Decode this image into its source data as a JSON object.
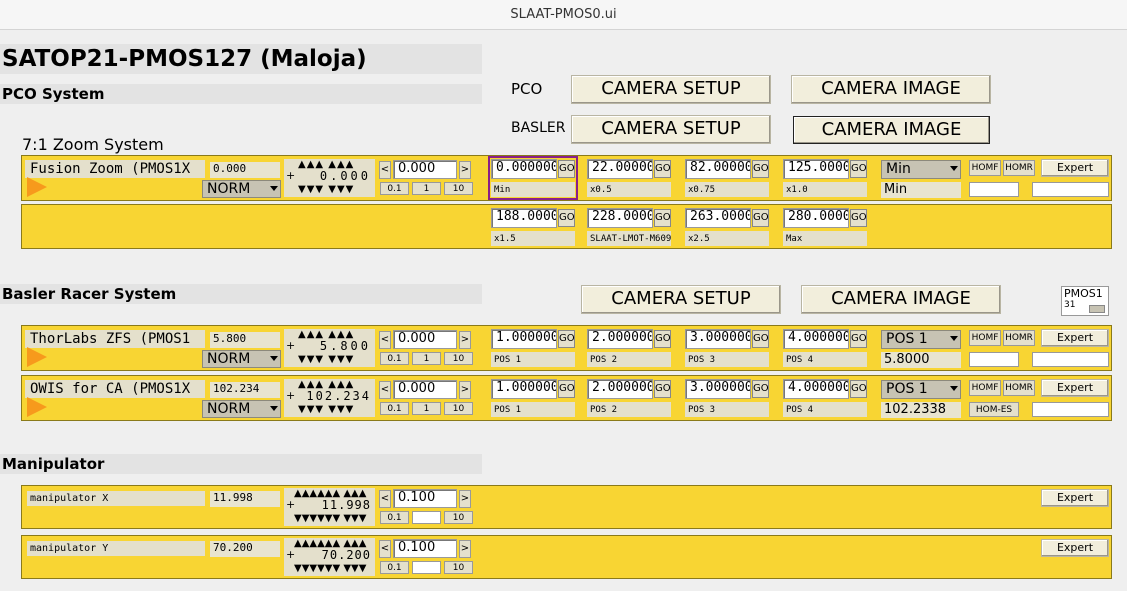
{
  "window": {
    "title": "SLAAT-PMOS0.ui"
  },
  "main_title": "SATOP21-PMOS127 (Maloja)",
  "pco_system": {
    "title": "PCO System",
    "pco_label": "PCO",
    "basler_label": "BASLER",
    "camera_setup": "CAMERA SETUP",
    "camera_image": "CAMERA IMAGE",
    "zoom_label": "7:1 Zoom System"
  },
  "motor_common": {
    "norm": "NORM",
    "tweak_value": "0.000",
    "s1": "0.1",
    "s2": "1",
    "s3": "10",
    "go": "GO",
    "homf": "HOMF",
    "homr": "HOMR",
    "expert": "Expert",
    "left": "<",
    "right": ">",
    "plus": "+",
    "up_arrows": "▲▲▲ ▲▲▲",
    "down_arrows": "▼▼▼ ▼▼▼"
  },
  "fusion": {
    "name": "Fusion Zoom (PMOS1X",
    "readback": "0.000",
    "spin": "0.000",
    "positions": [
      {
        "value": "0.000000",
        "label": "Min"
      },
      {
        "value": "22.00000",
        "label": "x0.5"
      },
      {
        "value": "82.00000",
        "label": "x0.75"
      },
      {
        "value": "125.0000",
        "label": "x1.0"
      },
      {
        "value": "188.0000",
        "label": "x1.5"
      },
      {
        "value": "228.0000",
        "label": "SLAAT-LMOT-M609"
      },
      {
        "value": "263.0000",
        "label": "x2.5"
      },
      {
        "value": "280.0000",
        "label": "Max"
      }
    ],
    "selector": "Min",
    "selector_rbv": "Min"
  },
  "basler_system": {
    "title": "Basler Racer System",
    "camera_setup": "CAMERA SETUP",
    "camera_image": "CAMERA IMAGE",
    "pmos_label": "PMOS1",
    "pmos_value": "31"
  },
  "thorlabs": {
    "name": "ThorLabs ZFS (PMOS1",
    "readback": "5.800",
    "spin": "5.800",
    "positions": [
      {
        "value": "1.000000",
        "label": "POS 1"
      },
      {
        "value": "2.000000",
        "label": "POS 2"
      },
      {
        "value": "3.000000",
        "label": "POS 3"
      },
      {
        "value": "4.000000",
        "label": "POS 4"
      }
    ],
    "selector": "POS 1",
    "selector_rbv": "5.8000"
  },
  "owis": {
    "name": "OWIS for CA (PMOS1X",
    "readback": "102.234",
    "spin": "102.234",
    "positions": [
      {
        "value": "1.000000",
        "label": "POS 1"
      },
      {
        "value": "2.000000",
        "label": "POS 2"
      },
      {
        "value": "3.000000",
        "label": "POS 3"
      },
      {
        "value": "4.000000",
        "label": "POS 4"
      }
    ],
    "selector": "POS 1",
    "selector_rbv": "102.2338",
    "hom_es": "HOM-ES"
  },
  "manipulator": {
    "title": "Manipulator",
    "x": {
      "name": "manipulator X",
      "readback": "11.998",
      "spin": "11.998",
      "tweak": "0.100"
    },
    "y": {
      "name": "manipulator Y",
      "readback": "70.200",
      "spin": "70.200",
      "tweak": "0.100"
    },
    "up_arrows": "▲▲▲▲▲▲ ▲▲▲",
    "down_arrows": "▼▼▼▼▼▼ ▼▼▼"
  }
}
